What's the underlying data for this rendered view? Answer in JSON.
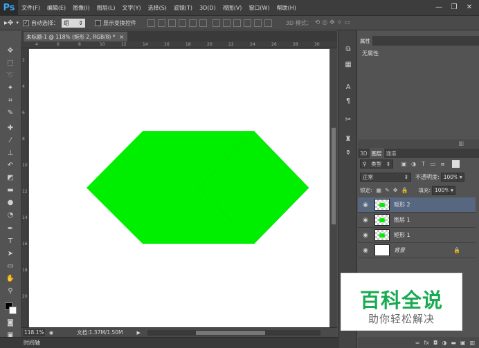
{
  "app": {
    "logo": "Ps"
  },
  "menu": [
    "文件(F)",
    "编辑(E)",
    "图像(I)",
    "图层(L)",
    "文字(Y)",
    "选择(S)",
    "滤镜(T)",
    "3D(D)",
    "视图(V)",
    "窗口(W)",
    "帮助(H)"
  ],
  "window_controls": {
    "minimize": "—",
    "restore": "❐",
    "close": "✕"
  },
  "options": {
    "auto_select_label": "自动选择：",
    "auto_select_value": "组",
    "show_transform_label": "显示变换控件",
    "mode_3d_label": "3D 模式："
  },
  "document": {
    "tab_title": "未标题-1 @ 118% (矩形 2, RGB/8) *",
    "tab_close": "×"
  },
  "ruler": {
    "h": [
      "4",
      "6",
      "8",
      "10",
      "12",
      "14",
      "16",
      "18",
      "20",
      "22",
      "24",
      "26",
      "28",
      "30"
    ],
    "v": [
      "2",
      "4",
      "6",
      "8",
      "10",
      "12",
      "14",
      "16",
      "18",
      "20"
    ]
  },
  "canvas": {
    "shape_color": "#00ee00",
    "background": "#ffffff"
  },
  "status": {
    "zoom": "118.1%",
    "doc_info": "文档:1.37M/1.50M"
  },
  "timeline": {
    "label": "时间轴"
  },
  "properties": {
    "tab": "属性",
    "body": "无属性"
  },
  "layers_panel": {
    "tabs": [
      "3D",
      "图层",
      "通道"
    ],
    "filter_kind": "类型",
    "blend_mode": "正常",
    "opacity_label": "不透明度:",
    "opacity_value": "100%",
    "lock_label": "锁定:",
    "fill_label": "填充:",
    "fill_value": "100%",
    "layers": [
      {
        "name": "矩形 2",
        "selected": true
      },
      {
        "name": "图层 1",
        "selected": false
      },
      {
        "name": "矩形 1",
        "selected": false
      },
      {
        "name": "背景",
        "selected": false
      }
    ]
  },
  "watermark": {
    "title": "百科全说",
    "subtitle": "助你轻松解决"
  }
}
